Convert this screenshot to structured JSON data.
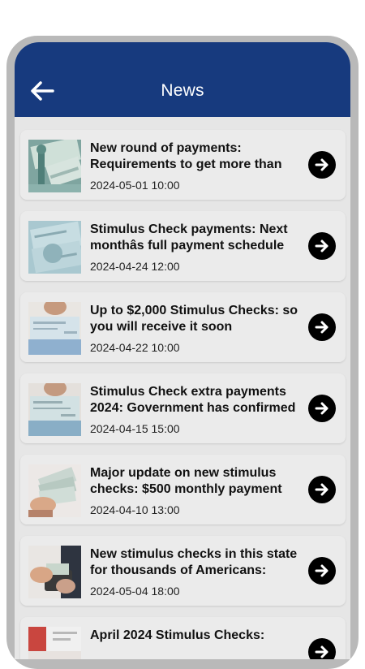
{
  "header": {
    "title": "News",
    "back_icon": "arrow-left-icon",
    "background": "#173a7e"
  },
  "items": [
    {
      "title": "New round of payments: Requirements to get more than",
      "date": "2024-05-01 10:00",
      "icon": "arrow-right-circle-icon"
    },
    {
      "title": "Stimulus Check payments: Next monthâs full payment schedule",
      "date": "2024-04-24 12:00",
      "icon": "arrow-right-circle-icon"
    },
    {
      "title": "Up to $2,000 Stimulus Checks: so you will receive it soon",
      "date": "2024-04-22 10:00",
      "icon": "arrow-right-circle-icon"
    },
    {
      "title": "Stimulus Check extra payments 2024: Government has confirmed",
      "date": "2024-04-15 15:00",
      "icon": "arrow-right-circle-icon"
    },
    {
      "title": "Major update on new stimulus checks: $500 monthly payment",
      "date": "2024-04-10 13:00",
      "icon": "arrow-right-circle-icon"
    },
    {
      "title": "New stimulus checks in this state for thousands of Americans:",
      "date": "2024-05-04 18:00",
      "icon": "arrow-right-circle-icon"
    },
    {
      "title": "April 2024 Stimulus Checks:",
      "date": "",
      "icon": "arrow-right-circle-icon"
    }
  ]
}
